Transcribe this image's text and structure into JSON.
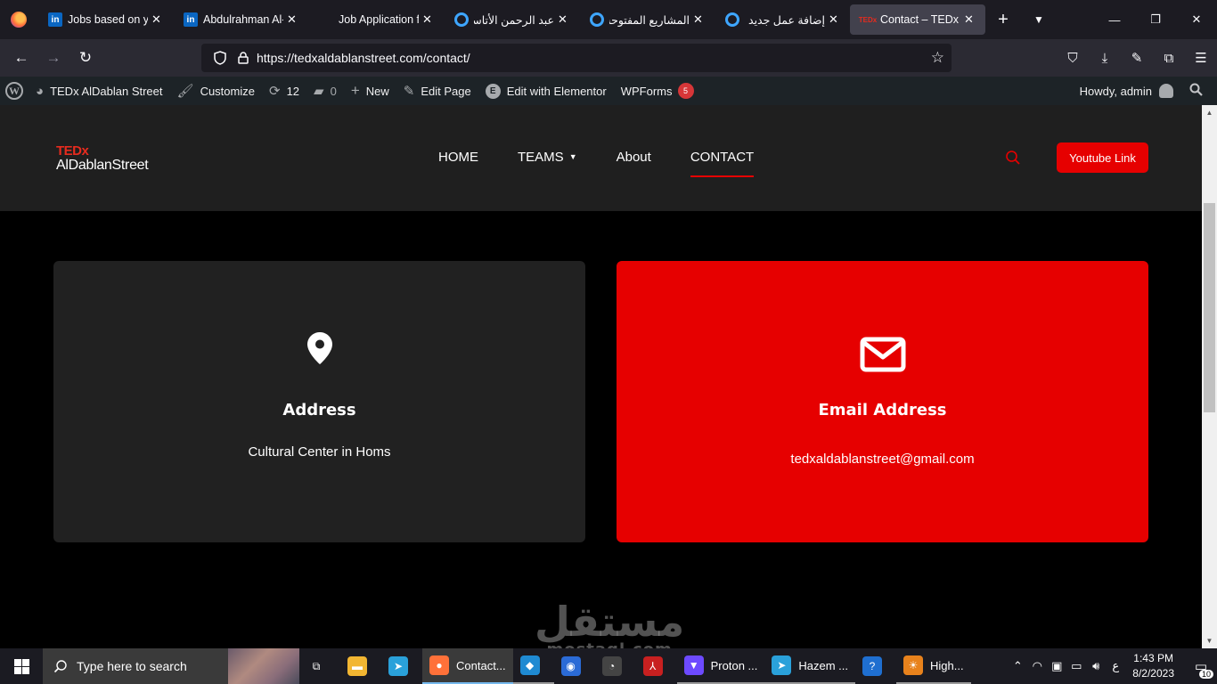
{
  "browser": {
    "tabs": [
      {
        "title": "Jobs based on your",
        "icon": "linkedin-icon",
        "icon_text": "in",
        "active": false,
        "rtl": false
      },
      {
        "title": "Abdulrahman Al-",
        "icon": "linkedin-icon",
        "icon_text": "in",
        "active": false,
        "rtl": false
      },
      {
        "title": "Job Application fo",
        "icon": "blank-icon",
        "icon_text": "",
        "active": false,
        "rtl": false
      },
      {
        "title": "عبد الرحمن الأتاسي",
        "icon": "ring-icon",
        "icon_text": "",
        "active": false,
        "rtl": true
      },
      {
        "title": "المشاريع المفتوحة",
        "icon": "ring-icon",
        "icon_text": "",
        "active": false,
        "rtl": true
      },
      {
        "title": "إضافة عمل جديد |",
        "icon": "ring-icon",
        "icon_text": "",
        "active": false,
        "rtl": true
      },
      {
        "title": "Contact – TEDx Al",
        "icon": "ted-icon",
        "icon_text": "TEDx",
        "active": true,
        "rtl": false
      }
    ],
    "url": "https://tedxaldablanstreet.com/contact/"
  },
  "wp_admin_bar": {
    "site_name": "TEDx AlDablan Street",
    "customize": "Customize",
    "updates_count": "12",
    "comments_count": "0",
    "new_label": "New",
    "edit_page": "Edit Page",
    "edit_elementor": "Edit with Elementor",
    "wpforms": "WPForms",
    "wpforms_badge": "5",
    "howdy": "Howdy, admin"
  },
  "site": {
    "logo_ted": "TEDx",
    "logo_name": "AlDablanStreet",
    "menu": [
      {
        "label": "HOME",
        "active": false,
        "has_caret": false
      },
      {
        "label": "TEAMS",
        "active": false,
        "has_caret": true
      },
      {
        "label": "About",
        "active": false,
        "has_caret": false
      },
      {
        "label": "CONTACT",
        "active": true,
        "has_caret": false
      }
    ],
    "youtube_button": "Youtube Link",
    "accent": "#e60000"
  },
  "cards": {
    "address": {
      "title": "Address",
      "text": "Cultural Center in Homs"
    },
    "email": {
      "title": "Email Address",
      "text": "tedxaldablanstreet@gmail.com"
    }
  },
  "watermark": {
    "text": "مستقل",
    "sub": "mostaql.com"
  },
  "taskbar": {
    "search_placeholder": "Type here to search",
    "apps": [
      {
        "label": "",
        "icon": "task-view-icon",
        "glyph": "⧉",
        "color": "transparent",
        "state": "none"
      },
      {
        "label": "",
        "icon": "file-explorer-icon",
        "glyph": "▬",
        "color": "#f2b632",
        "state": "none"
      },
      {
        "label": "",
        "icon": "telegram-icon",
        "glyph": "➤",
        "color": "#2aa1da",
        "state": "none"
      },
      {
        "label": "Contact...",
        "icon": "firefox-icon",
        "glyph": "●",
        "color": "#ff7139",
        "state": "active"
      },
      {
        "label": "",
        "icon": "vscode-icon",
        "glyph": "◆",
        "color": "#1f8ad2",
        "state": "run"
      },
      {
        "label": "",
        "icon": "browser-icon",
        "glyph": "◉",
        "color": "#2b6bd6",
        "state": "none"
      },
      {
        "label": "",
        "icon": "speedometer-icon",
        "glyph": "◔",
        "color": "#444",
        "state": "none"
      },
      {
        "label": "",
        "icon": "pdf-icon",
        "glyph": "⅄",
        "color": "#c82020",
        "state": "none"
      },
      {
        "label": "Proton ...",
        "icon": "proton-vpn-icon",
        "glyph": "▼",
        "color": "#6d4aff",
        "state": "run"
      },
      {
        "label": "Hazem ...",
        "icon": "telegram-icon",
        "glyph": "➤",
        "color": "#2aa1da",
        "state": "run"
      },
      {
        "label": "",
        "icon": "help-icon",
        "glyph": "?",
        "color": "#1f6fd0",
        "state": "none"
      },
      {
        "label": "High...",
        "icon": "app-icon",
        "glyph": "☀",
        "color": "#e8821c",
        "state": "run"
      }
    ],
    "keyboard_lang": "ع",
    "time": "1:43 PM",
    "date": "8/2/2023",
    "notifications": "10"
  }
}
